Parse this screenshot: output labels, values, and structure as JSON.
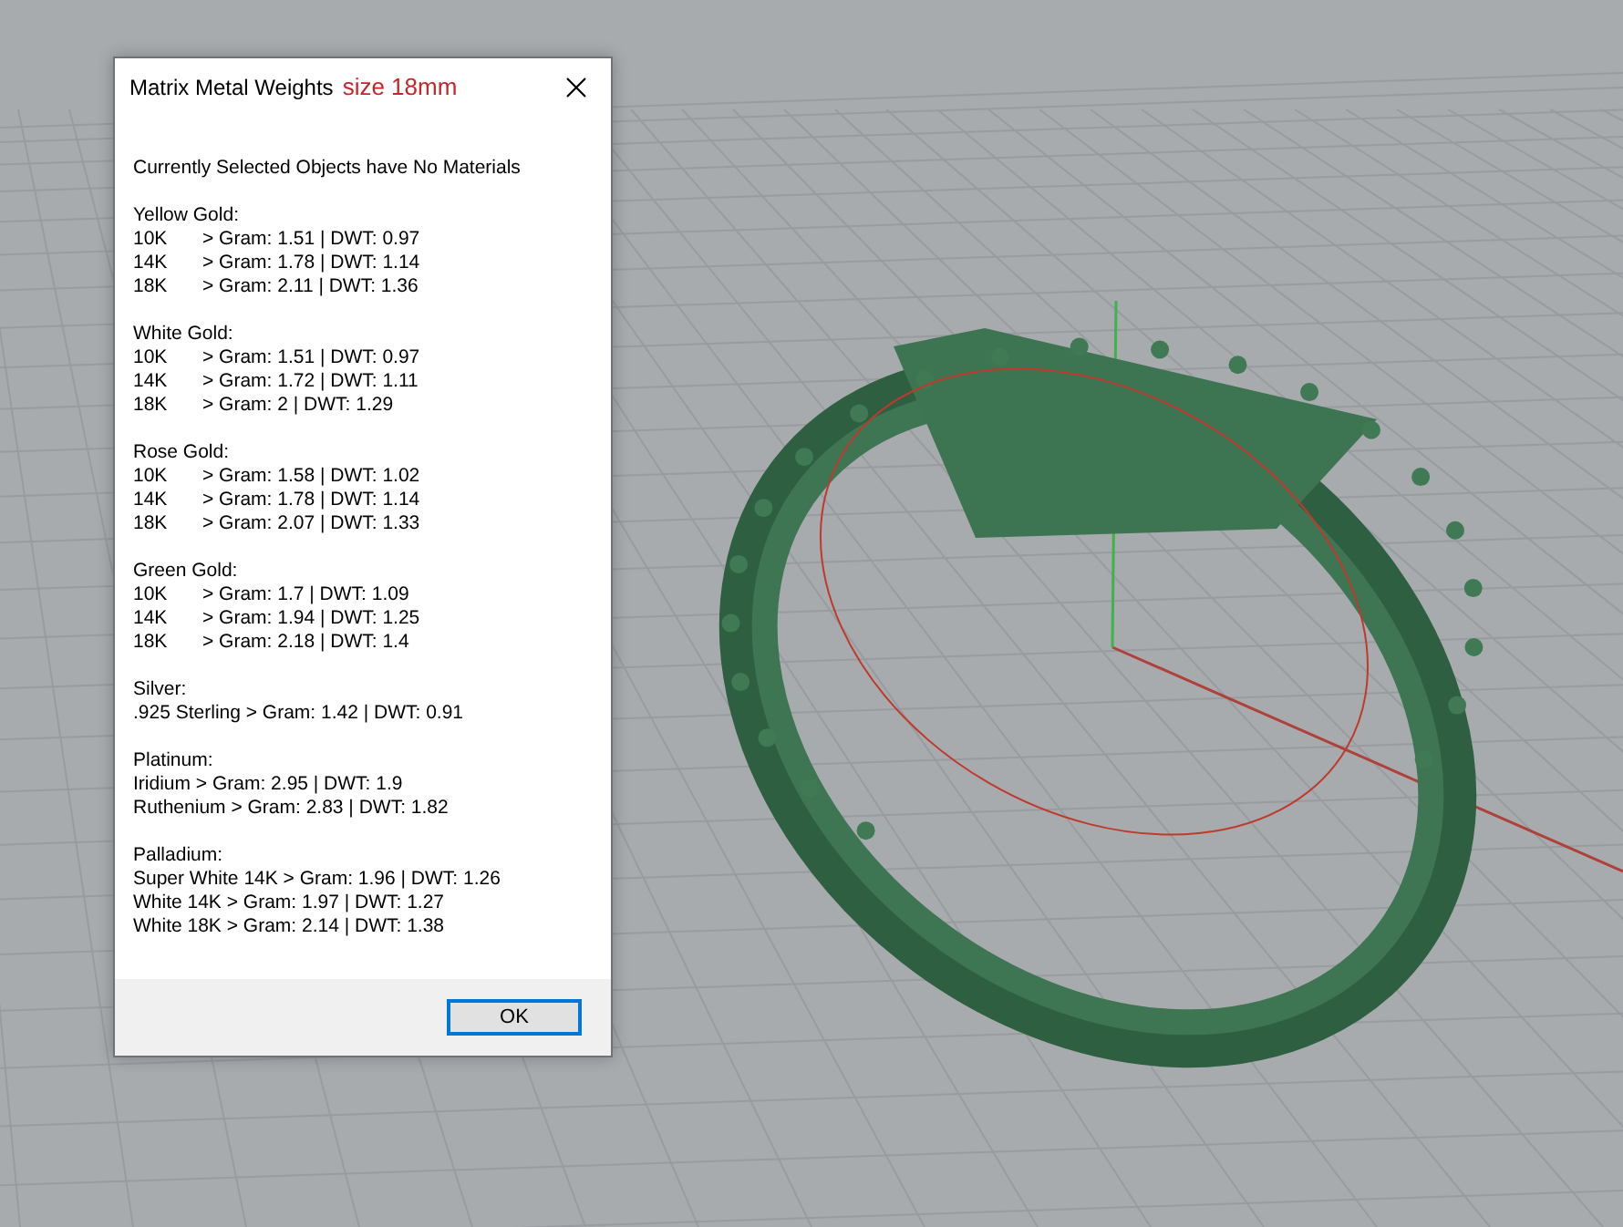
{
  "dialog": {
    "title": "Matrix Metal Weights",
    "title_note": "size 18mm",
    "message": "Currently Selected Objects have No Materials",
    "groups": [
      {
        "name": "Yellow Gold:",
        "rows": [
          {
            "kind": "tabbed",
            "label": "10K",
            "value": "> Gram: 1.51 | DWT: 0.97"
          },
          {
            "kind": "tabbed",
            "label": "14K",
            "value": "> Gram: 1.78 | DWT: 1.14"
          },
          {
            "kind": "tabbed",
            "label": "18K",
            "value": "> Gram: 2.11 | DWT: 1.36"
          }
        ]
      },
      {
        "name": "White Gold:",
        "rows": [
          {
            "kind": "tabbed",
            "label": "10K",
            "value": "> Gram: 1.51 | DWT: 0.97"
          },
          {
            "kind": "tabbed",
            "label": "14K",
            "value": "> Gram: 1.72 | DWT: 1.11"
          },
          {
            "kind": "tabbed",
            "label": "18K",
            "value": "> Gram: 2 | DWT: 1.29"
          }
        ]
      },
      {
        "name": "Rose Gold:",
        "rows": [
          {
            "kind": "tabbed",
            "label": "10K",
            "value": "> Gram: 1.58 | DWT: 1.02"
          },
          {
            "kind": "tabbed",
            "label": "14K",
            "value": "> Gram: 1.78 | DWT: 1.14"
          },
          {
            "kind": "tabbed",
            "label": "18K",
            "value": "> Gram: 2.07 | DWT: 1.33"
          }
        ]
      },
      {
        "name": "Green Gold:",
        "rows": [
          {
            "kind": "tabbed",
            "label": "10K",
            "value": "> Gram: 1.7 | DWT: 1.09"
          },
          {
            "kind": "tabbed",
            "label": "14K",
            "value": "> Gram: 1.94 | DWT: 1.25"
          },
          {
            "kind": "tabbed",
            "label": "18K",
            "value": "> Gram: 2.18 | DWT: 1.4"
          }
        ]
      },
      {
        "name": "Silver:",
        "rows": [
          {
            "kind": "inline",
            "text": ".925 Sterling > Gram: 1.42 | DWT: 0.91"
          }
        ]
      },
      {
        "name": "Platinum:",
        "rows": [
          {
            "kind": "inline",
            "text": "Iridium > Gram: 2.95 | DWT: 1.9"
          },
          {
            "kind": "inline",
            "text": "Ruthenium > Gram: 2.83 | DWT: 1.82"
          }
        ]
      },
      {
        "name": "Palladium:",
        "rows": [
          {
            "kind": "inline",
            "text": "Super White 14K > Gram: 1.96 | DWT: 1.26"
          },
          {
            "kind": "inline",
            "text": "White 14K > Gram: 1.97 | DWT: 1.27"
          },
          {
            "kind": "inline",
            "text": "White 18K > Gram: 2.14 | DWT: 1.38"
          }
        ]
      }
    ],
    "button": "OK"
  }
}
